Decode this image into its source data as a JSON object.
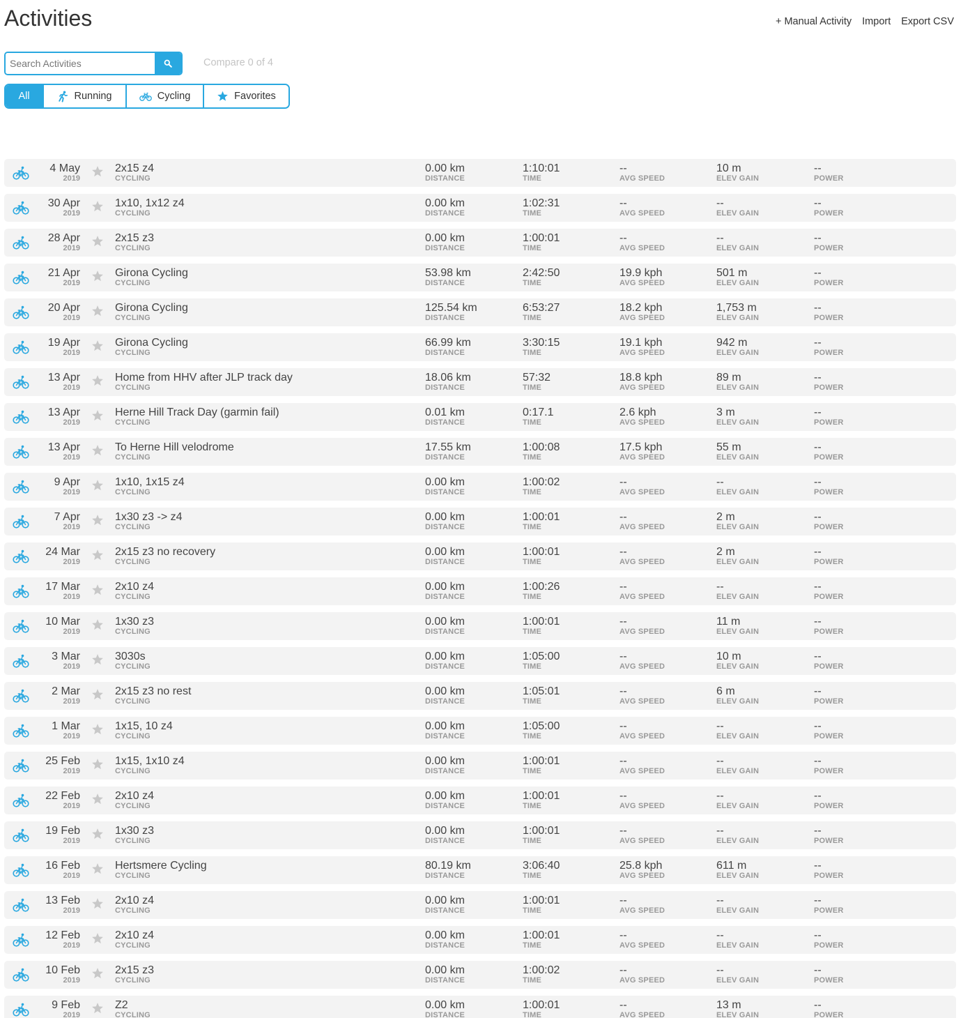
{
  "header": {
    "title": "Activities",
    "actions": [
      "+ Manual Activity",
      "Import",
      "Export CSV"
    ]
  },
  "search": {
    "placeholder": "Search Activities",
    "icon": "search-icon"
  },
  "compare": "Compare 0 of 4",
  "filters": [
    {
      "label": "All",
      "icon": "",
      "active": true
    },
    {
      "label": "Running",
      "icon": "running-icon",
      "active": false
    },
    {
      "label": "Cycling",
      "icon": "bike-icon",
      "active": false
    },
    {
      "label": "Favorites",
      "icon": "star-icon",
      "active": false
    }
  ],
  "colors": {
    "accent": "#29a8e0",
    "row_bg": "#f3f3f3",
    "star": "#c8c8c8"
  },
  "labels": {
    "distance": "DISTANCE",
    "time": "TIME",
    "avg_speed": "AVG SPEED",
    "elev_gain": "ELEV GAIN",
    "power": "POWER"
  },
  "activities": [
    {
      "date": "4 May",
      "year": "2019",
      "name": "2x15 z4",
      "type": "CYCLING",
      "distance": "0.00 km",
      "time": "1:10:01",
      "avg_speed": "--",
      "elev_gain": "10 m",
      "power": "--"
    },
    {
      "date": "30 Apr",
      "year": "2019",
      "name": "1x10, 1x12 z4",
      "type": "CYCLING",
      "distance": "0.00 km",
      "time": "1:02:31",
      "avg_speed": "--",
      "elev_gain": "--",
      "power": "--"
    },
    {
      "date": "28 Apr",
      "year": "2019",
      "name": "2x15 z3",
      "type": "CYCLING",
      "distance": "0.00 km",
      "time": "1:00:01",
      "avg_speed": "--",
      "elev_gain": "--",
      "power": "--"
    },
    {
      "date": "21 Apr",
      "year": "2019",
      "name": "Girona Cycling",
      "type": "CYCLING",
      "distance": "53.98 km",
      "time": "2:42:50",
      "avg_speed": "19.9 kph",
      "elev_gain": "501 m",
      "power": "--"
    },
    {
      "date": "20 Apr",
      "year": "2019",
      "name": "Girona Cycling",
      "type": "CYCLING",
      "distance": "125.54 km",
      "time": "6:53:27",
      "avg_speed": "18.2 kph",
      "elev_gain": "1,753 m",
      "power": "--"
    },
    {
      "date": "19 Apr",
      "year": "2019",
      "name": "Girona Cycling",
      "type": "CYCLING",
      "distance": "66.99 km",
      "time": "3:30:15",
      "avg_speed": "19.1 kph",
      "elev_gain": "942 m",
      "power": "--"
    },
    {
      "date": "13 Apr",
      "year": "2019",
      "name": "Home from HHV after JLP track day",
      "type": "CYCLING",
      "distance": "18.06 km",
      "time": "57:32",
      "avg_speed": "18.8 kph",
      "elev_gain": "89 m",
      "power": "--"
    },
    {
      "date": "13 Apr",
      "year": "2019",
      "name": "Herne Hill Track Day (garmin fail)",
      "type": "CYCLING",
      "distance": "0.01 km",
      "time": "0:17.1",
      "avg_speed": "2.6 kph",
      "elev_gain": "3 m",
      "power": "--"
    },
    {
      "date": "13 Apr",
      "year": "2019",
      "name": "To Herne Hill velodrome",
      "type": "CYCLING",
      "distance": "17.55 km",
      "time": "1:00:08",
      "avg_speed": "17.5 kph",
      "elev_gain": "55 m",
      "power": "--"
    },
    {
      "date": "9 Apr",
      "year": "2019",
      "name": "1x10, 1x15 z4",
      "type": "CYCLING",
      "distance": "0.00 km",
      "time": "1:00:02",
      "avg_speed": "--",
      "elev_gain": "--",
      "power": "--"
    },
    {
      "date": "7 Apr",
      "year": "2019",
      "name": "1x30 z3 -> z4",
      "type": "CYCLING",
      "distance": "0.00 km",
      "time": "1:00:01",
      "avg_speed": "--",
      "elev_gain": "2 m",
      "power": "--"
    },
    {
      "date": "24 Mar",
      "year": "2019",
      "name": "2x15 z3 no recovery",
      "type": "CYCLING",
      "distance": "0.00 km",
      "time": "1:00:01",
      "avg_speed": "--",
      "elev_gain": "2 m",
      "power": "--"
    },
    {
      "date": "17 Mar",
      "year": "2019",
      "name": "2x10 z4",
      "type": "CYCLING",
      "distance": "0.00 km",
      "time": "1:00:26",
      "avg_speed": "--",
      "elev_gain": "--",
      "power": "--"
    },
    {
      "date": "10 Mar",
      "year": "2019",
      "name": "1x30 z3",
      "type": "CYCLING",
      "distance": "0.00 km",
      "time": "1:00:01",
      "avg_speed": "--",
      "elev_gain": "11 m",
      "power": "--"
    },
    {
      "date": "3 Mar",
      "year": "2019",
      "name": "3030s",
      "type": "CYCLING",
      "distance": "0.00 km",
      "time": "1:05:00",
      "avg_speed": "--",
      "elev_gain": "10 m",
      "power": "--"
    },
    {
      "date": "2 Mar",
      "year": "2019",
      "name": "2x15 z3 no rest",
      "type": "CYCLING",
      "distance": "0.00 km",
      "time": "1:05:01",
      "avg_speed": "--",
      "elev_gain": "6 m",
      "power": "--"
    },
    {
      "date": "1 Mar",
      "year": "2019",
      "name": "1x15, 10 z4",
      "type": "CYCLING",
      "distance": "0.00 km",
      "time": "1:05:00",
      "avg_speed": "--",
      "elev_gain": "--",
      "power": "--"
    },
    {
      "date": "25 Feb",
      "year": "2019",
      "name": "1x15, 1x10 z4",
      "type": "CYCLING",
      "distance": "0.00 km",
      "time": "1:00:01",
      "avg_speed": "--",
      "elev_gain": "--",
      "power": "--"
    },
    {
      "date": "22 Feb",
      "year": "2019",
      "name": "2x10 z4",
      "type": "CYCLING",
      "distance": "0.00 km",
      "time": "1:00:01",
      "avg_speed": "--",
      "elev_gain": "--",
      "power": "--"
    },
    {
      "date": "19 Feb",
      "year": "2019",
      "name": "1x30 z3",
      "type": "CYCLING",
      "distance": "0.00 km",
      "time": "1:00:01",
      "avg_speed": "--",
      "elev_gain": "--",
      "power": "--"
    },
    {
      "date": "16 Feb",
      "year": "2019",
      "name": "Hertsmere Cycling",
      "type": "CYCLING",
      "distance": "80.19 km",
      "time": "3:06:40",
      "avg_speed": "25.8 kph",
      "elev_gain": "611 m",
      "power": "--"
    },
    {
      "date": "13 Feb",
      "year": "2019",
      "name": "2x10 z4",
      "type": "CYCLING",
      "distance": "0.00 km",
      "time": "1:00:01",
      "avg_speed": "--",
      "elev_gain": "--",
      "power": "--"
    },
    {
      "date": "12 Feb",
      "year": "2019",
      "name": "2x10 z4",
      "type": "CYCLING",
      "distance": "0.00 km",
      "time": "1:00:01",
      "avg_speed": "--",
      "elev_gain": "--",
      "power": "--"
    },
    {
      "date": "10 Feb",
      "year": "2019",
      "name": "2x15 z3",
      "type": "CYCLING",
      "distance": "0.00 km",
      "time": "1:00:02",
      "avg_speed": "--",
      "elev_gain": "--",
      "power": "--"
    },
    {
      "date": "9 Feb",
      "year": "2019",
      "name": "Z2",
      "type": "CYCLING",
      "distance": "0.00 km",
      "time": "1:00:01",
      "avg_speed": "--",
      "elev_gain": "13 m",
      "power": "--"
    }
  ]
}
